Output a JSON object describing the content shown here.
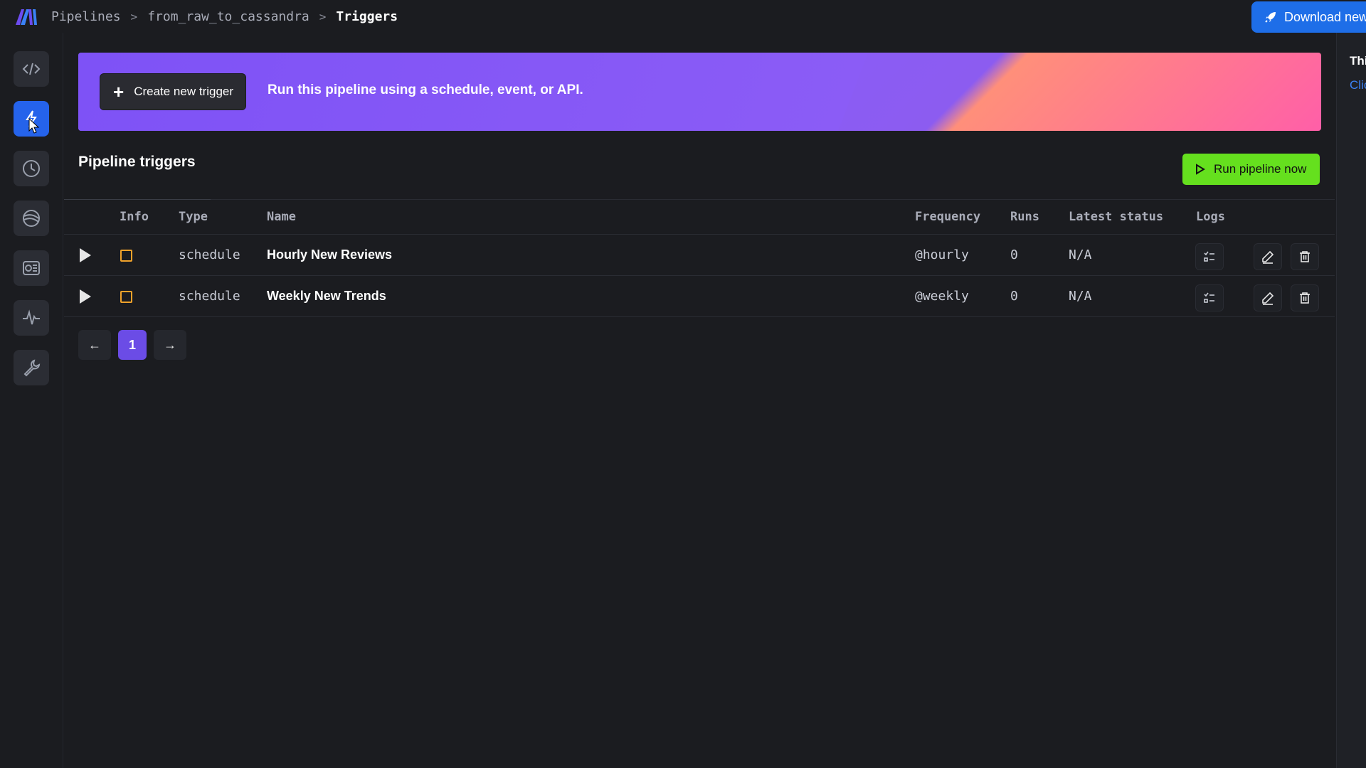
{
  "breadcrumb": {
    "items": [
      "Pipelines",
      "from_raw_to_cassandra"
    ],
    "current": "Triggers",
    "separator": ">"
  },
  "header": {
    "download_label": "Download new"
  },
  "sidebar": {
    "items": [
      {
        "name": "code-icon",
        "active": false
      },
      {
        "name": "trigger-icon",
        "active": true
      },
      {
        "name": "clock-icon",
        "active": false
      },
      {
        "name": "globe-icon",
        "active": false
      },
      {
        "name": "monitor-icon",
        "active": false
      },
      {
        "name": "activity-icon",
        "active": false
      },
      {
        "name": "wrench-icon",
        "active": false
      }
    ]
  },
  "banner": {
    "create_label": "Create new trigger",
    "text": "Run this pipeline using a schedule, event, or API."
  },
  "section": {
    "title": "Pipeline triggers",
    "run_label": "Run pipeline now"
  },
  "table": {
    "headers": {
      "info": "Info",
      "type": "Type",
      "name": "Name",
      "frequency": "Frequency",
      "runs": "Runs",
      "latest_status": "Latest status",
      "logs": "Logs"
    },
    "rows": [
      {
        "type": "schedule",
        "name": "Hourly New Reviews",
        "frequency": "@hourly",
        "runs": "0",
        "latest_status": "N/A"
      },
      {
        "type": "schedule",
        "name": "Weekly New Trends",
        "frequency": "@weekly",
        "runs": "0",
        "latest_status": "N/A"
      }
    ]
  },
  "pagination": {
    "prev": "←",
    "current_page": "1",
    "next": "→"
  },
  "right_panel": {
    "line1": "Thi",
    "line2": "Clic"
  },
  "colors": {
    "accent": "#2563eb",
    "run_button": "#65e01e",
    "page_active": "#6b4ce6",
    "banner_purple": "#8b5cf6",
    "banner_pink": "#ff5fa8",
    "info_box": "#f0a22b"
  }
}
